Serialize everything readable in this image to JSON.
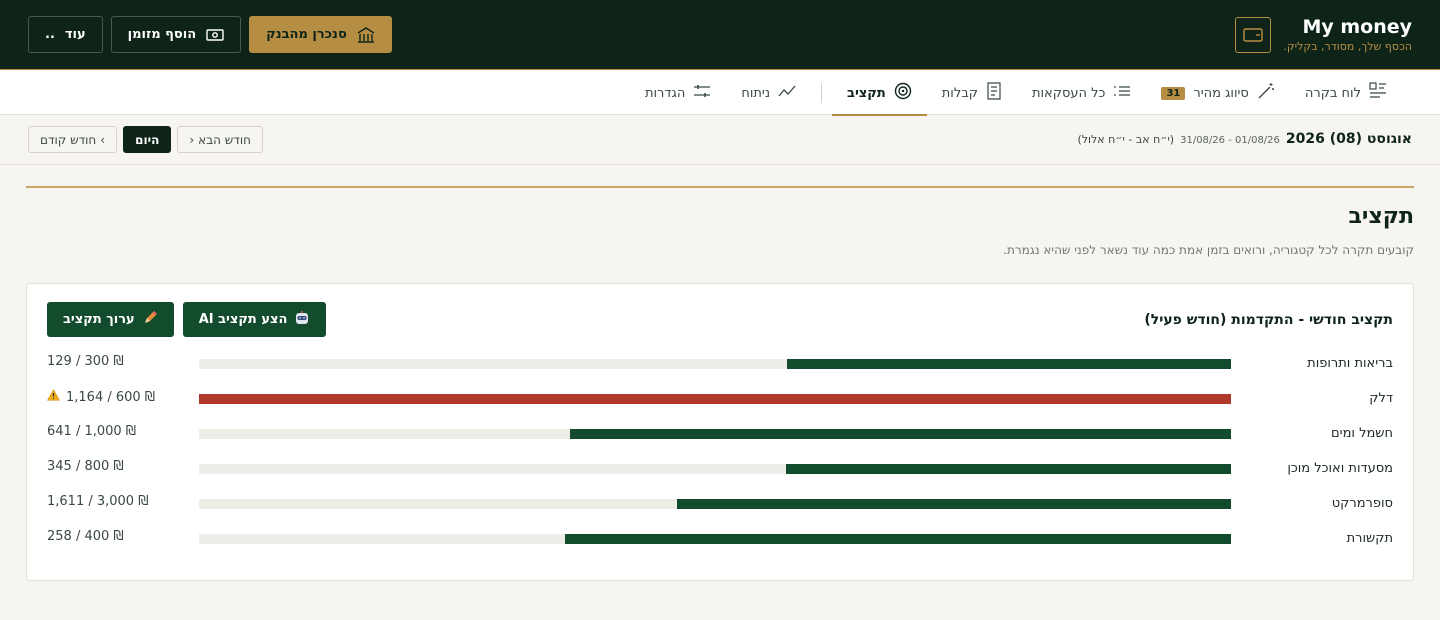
{
  "brand": {
    "title": "My money",
    "subtitle": "הכסף שלך, מסודר, בקליק."
  },
  "top_actions": {
    "sync_label": "סנכרן מהבנק",
    "add_cash_label": "הוסף מזומן",
    "more_label": "עוד",
    "more_dots": ".."
  },
  "nav": {
    "tabs": [
      {
        "label": "לוח בקרה",
        "icon": "dashboard-icon"
      },
      {
        "label": "סיווג מהיר",
        "icon": "wand-icon",
        "badge": "31"
      },
      {
        "label": "כל העסקאות",
        "icon": "list-icon"
      },
      {
        "label": "קבלות",
        "icon": "receipt-icon"
      },
      {
        "label": "תקציב",
        "icon": "budget-icon",
        "active": true
      },
      {
        "label": "ניתוח",
        "icon": "trend-icon"
      },
      {
        "label": "הגדרות",
        "icon": "sliders-icon"
      }
    ]
  },
  "period": {
    "title": "אוגוסט (08) 2026",
    "range": "01/08/26 - 31/08/26",
    "hebrew": "(י״ח אב - י״ח אלול)",
    "prev_label": "חודש קודם",
    "today_label": "היום",
    "next_label": "חודש הבא"
  },
  "page": {
    "title": "תקציב",
    "subtitle": "קובעים תקרה לכל קטגוריה, ורואים בזמן אמת כמה עוד נשאר לפני שהיא נגמרת."
  },
  "budget_card": {
    "title": "תקציב חודשי - התקדמות (חודש פעיל)",
    "ai_button": "הצע תקציב AI",
    "edit_button": "ערוך תקציב",
    "currency": "₪",
    "warning_icon": "⚠️",
    "rows": [
      {
        "label": "בריאות ותרופות",
        "spent": 129,
        "limit": 300,
        "amount_text": "129 / 300 ₪",
        "over": false
      },
      {
        "label": "דלק",
        "spent": 1164,
        "limit": 600,
        "amount_text": "1,164 / 600 ₪",
        "over": true
      },
      {
        "label": "חשמל ומים",
        "spent": 641,
        "limit": 1000,
        "amount_text": "641 / 1,000 ₪",
        "over": false
      },
      {
        "label": "מסעדות ואוכל מוכן",
        "spent": 345,
        "limit": 800,
        "amount_text": "345 / 800 ₪",
        "over": false
      },
      {
        "label": "סופרמרקט",
        "spent": 1611,
        "limit": 3000,
        "amount_text": "1,611 / 3,000 ₪",
        "over": false
      },
      {
        "label": "תקשורת",
        "spent": 258,
        "limit": 400,
        "amount_text": "258 / 400 ₪",
        "over": false
      }
    ]
  },
  "colors": {
    "header_bg": "#0e2418",
    "gold": "#b68e43",
    "bar_ok": "#134c2c",
    "bar_over": "#b0392c"
  }
}
